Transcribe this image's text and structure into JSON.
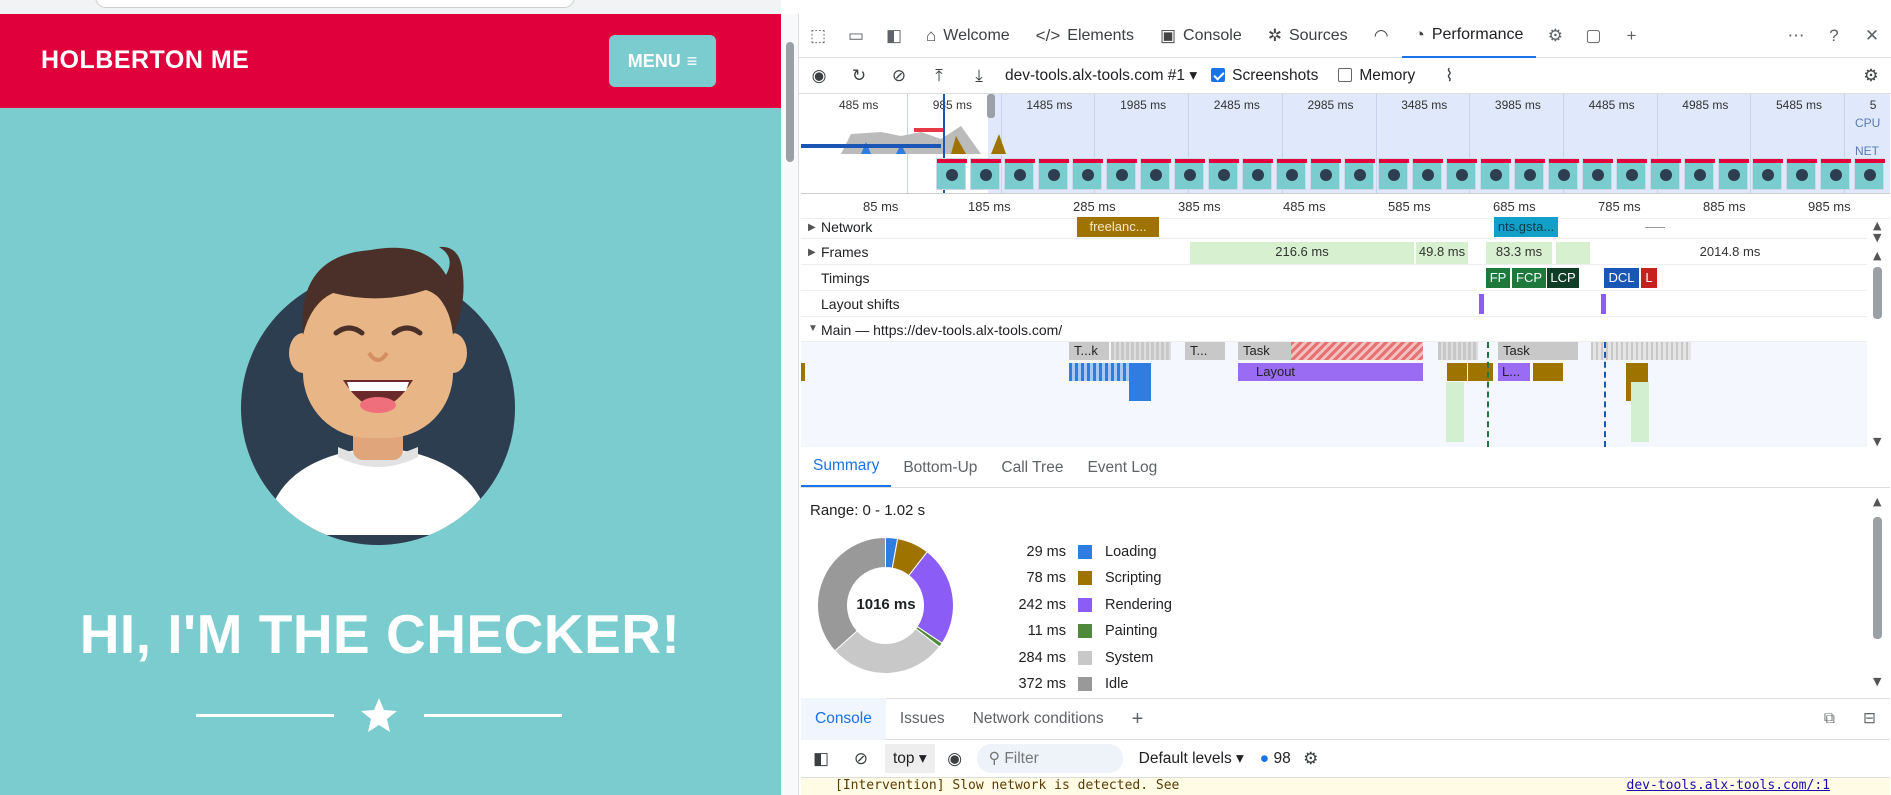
{
  "site": {
    "brand": "HOLBERTON ME",
    "menu_label": "MENU",
    "hero_title": "HI, I'M THE CHECKER!"
  },
  "devtools": {
    "tabs": [
      {
        "label": "Welcome",
        "icon": "home-icon"
      },
      {
        "label": "Elements",
        "icon": "code-icon"
      },
      {
        "label": "Console",
        "icon": "terminal-icon"
      },
      {
        "label": "Sources",
        "icon": "bug-icon"
      },
      {
        "label": "Performance",
        "icon": "performance-icon"
      }
    ],
    "active_tab": "Performance",
    "toolbar": {
      "profile_select": "dev-tools.alx-tools.com #1",
      "screenshots_label": "Screenshots",
      "screenshots_checked": true,
      "memory_label": "Memory",
      "memory_checked": false
    },
    "overview": {
      "ticks": [
        "485 ms",
        "985 ms",
        "1485 ms",
        "1985 ms",
        "2485 ms",
        "2985 ms",
        "3485 ms",
        "3985 ms",
        "4485 ms",
        "4985 ms",
        "5485 ms",
        "5"
      ],
      "cpu_label": "CPU",
      "net_label": "NET"
    },
    "ruler_ticks": [
      "85 ms",
      "185 ms",
      "285 ms",
      "385 ms",
      "485 ms",
      "585 ms",
      "685 ms",
      "785 ms",
      "885 ms",
      "985 ms"
    ],
    "tracks": {
      "network": {
        "label": "Network",
        "req1": "freelanc...",
        "req2": "nts.gsta..."
      },
      "frames": {
        "label": "Frames",
        "f1": "216.6 ms",
        "f2": "49.8 ms",
        "f3": "83.3 ms",
        "f4": "2014.8 ms"
      },
      "timings": {
        "label": "Timings",
        "markers": [
          "FP",
          "FCP",
          "LCP",
          "DCL",
          "L"
        ]
      },
      "layout_shifts": {
        "label": "Layout shifts"
      },
      "main": {
        "label": "Main — https://dev-tools.alx-tools.com/",
        "task1": "T...k",
        "task2": "T...",
        "task3": "Task",
        "task4": "Task",
        "layout": "Layout",
        "layout2": "L..."
      }
    },
    "summary_tabs": [
      "Summary",
      "Bottom-Up",
      "Call Tree",
      "Event Log"
    ],
    "summary": {
      "range": "Range: 0 - 1.02 s",
      "total": "1016 ms",
      "items": [
        {
          "value": "29 ms",
          "label": "Loading",
          "color": "#2f7de1",
          "ms": 29
        },
        {
          "value": "78 ms",
          "label": "Scripting",
          "color": "#9e7300",
          "ms": 78
        },
        {
          "value": "242 ms",
          "label": "Rendering",
          "color": "#8b5cf6",
          "ms": 242
        },
        {
          "value": "11 ms",
          "label": "Painting",
          "color": "#4f8a3c",
          "ms": 11
        },
        {
          "value": "284 ms",
          "label": "System",
          "color": "#c8c8c8",
          "ms": 284
        },
        {
          "value": "372 ms",
          "label": "Idle",
          "color": "#999999",
          "ms": 372
        }
      ]
    },
    "drawer_tabs": [
      "Console",
      "Issues",
      "Network conditions"
    ],
    "console_toolbar": {
      "context": "top",
      "filter_placeholder": "Filter",
      "levels": "Default levels",
      "count": "98"
    },
    "message": {
      "text": "[Intervention] Slow network is detected. See",
      "link": "dev-tools.alx-tools.com/:1"
    }
  }
}
